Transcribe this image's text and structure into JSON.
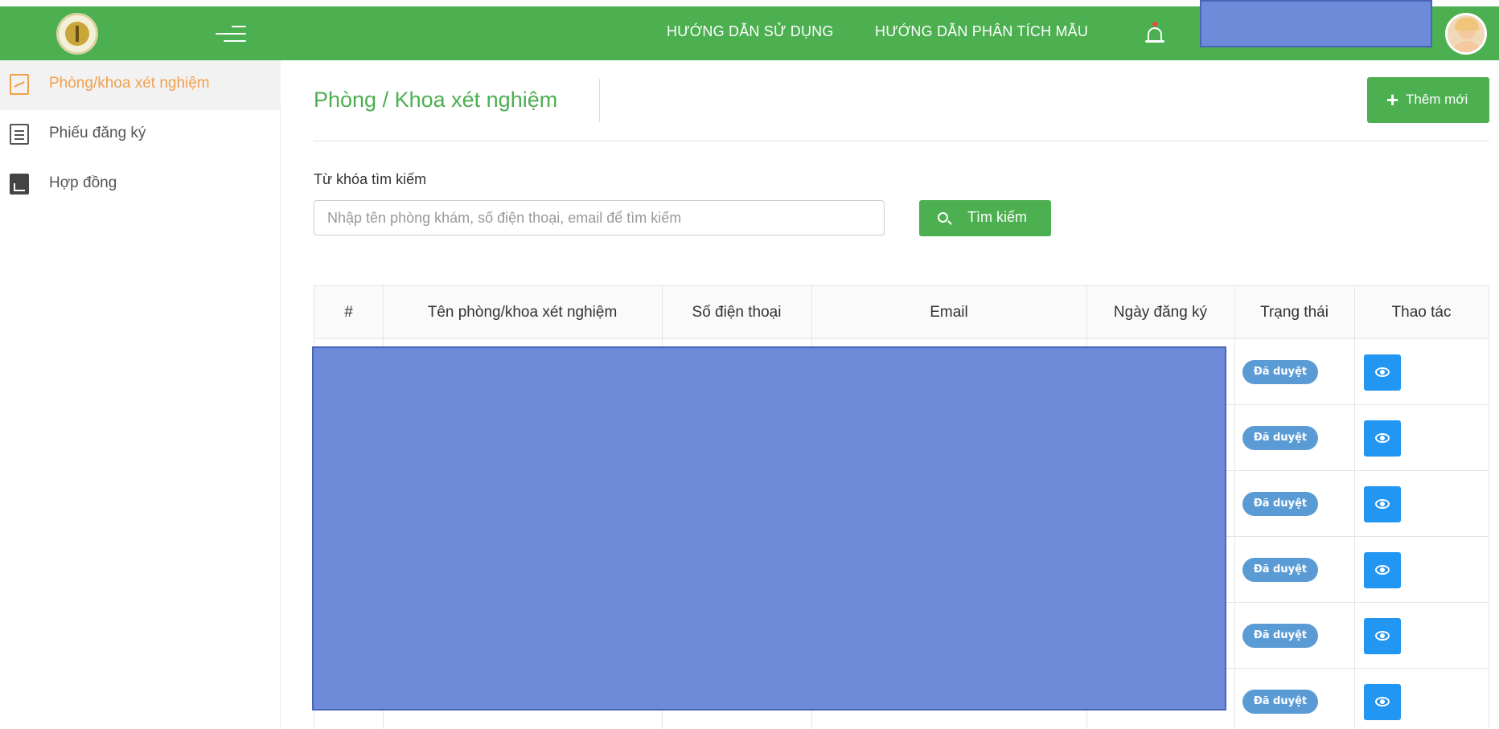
{
  "header": {
    "nav_links": [
      "HƯỚNG DẪN SỬ DỤNG",
      "HƯỚNG DẪN PHÂN TÍCH MẪU"
    ],
    "logo_icon": "scales-of-justice-icon",
    "menu_icon": "hamburger-menu-icon",
    "bell_icon": "bell-icon",
    "avatar_icon": "user-avatar-icon",
    "color": "#4caf50"
  },
  "sidebar": {
    "items": [
      {
        "label": "Phòng/khoa xét nghiệm",
        "icon": "chart-icon",
        "active": true
      },
      {
        "label": "Phiếu đăng ký",
        "icon": "document-icon",
        "active": false
      },
      {
        "label": "Hợp đồng",
        "icon": "pdf-icon",
        "active": false
      }
    ],
    "active_color": "#f0a04b"
  },
  "main": {
    "title": "Phòng / Khoa xét nghiệm",
    "add_button": "Thêm mới",
    "search": {
      "label": "Từ khóa tìm kiếm",
      "placeholder": "Nhập tên phòng khám, số điện thoại, email để tìm kiếm",
      "value": "",
      "button": "Tìm kiếm"
    },
    "table": {
      "columns": [
        "#",
        "Tên phòng/khoa xét nghiệm",
        "Số điện thoại",
        "Email",
        "Ngày đăng ký",
        "Trạng thái",
        "Thao tác"
      ],
      "rows": [
        {
          "status": "Đã duyệt",
          "action_icon": "eye-icon"
        },
        {
          "status": "Đã duyệt",
          "action_icon": "eye-icon"
        },
        {
          "status": "Đã duyệt",
          "action_icon": "eye-icon"
        },
        {
          "status": "Đã duyệt",
          "action_icon": "eye-icon"
        },
        {
          "status": "Đã duyệt",
          "action_icon": "eye-icon"
        },
        {
          "status": "Đã duyệt",
          "action_icon": "eye-icon"
        }
      ],
      "badge_color": "#5b9bd5",
      "action_color": "#2196f3"
    }
  }
}
